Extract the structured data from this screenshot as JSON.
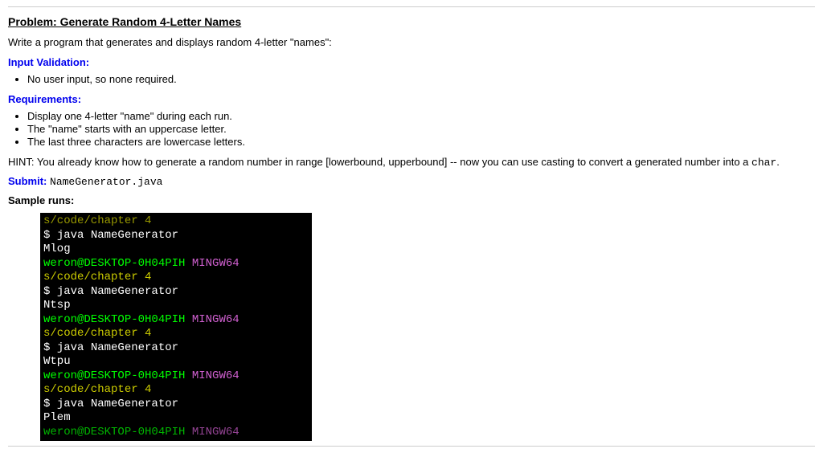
{
  "title": "Problem: Generate Random 4-Letter Names",
  "intro": "Write a program that generates and displays random 4-letter \"names\":",
  "inputValidationHeading": "Input Validation:",
  "inputValidationItems": [
    "No user input, so none required."
  ],
  "requirementsHeading": "Requirements:",
  "requirementsItems": [
    "Display one 4-letter \"name\" during each run.",
    "The \"name\" starts with an uppercase letter.",
    "The last three characters are lowercase letters."
  ],
  "hintPrefix": "HINT: You already know how to generate a random number in range [lowerbound, upperbound] -- now you can use casting to convert a generated number into a ",
  "hintCode": "char",
  "hintSuffix": ".",
  "submitLabel": "Submit:",
  "submitFile": "NameGenerator.java",
  "sampleRunsHeading": "Sample runs:",
  "terminal": {
    "pathTopFaded": "s/code/chapter 4",
    "prompt": "$ ",
    "cmd": "java NameGenerator",
    "out1": "Mlog",
    "out2": "Ntsp",
    "out3": "Wtpu",
    "out4": "Plem",
    "userHost": "weron@DESKTOP-0H04PIH",
    "shell": " MINGW64",
    "path": "s/code/chapter 4"
  }
}
